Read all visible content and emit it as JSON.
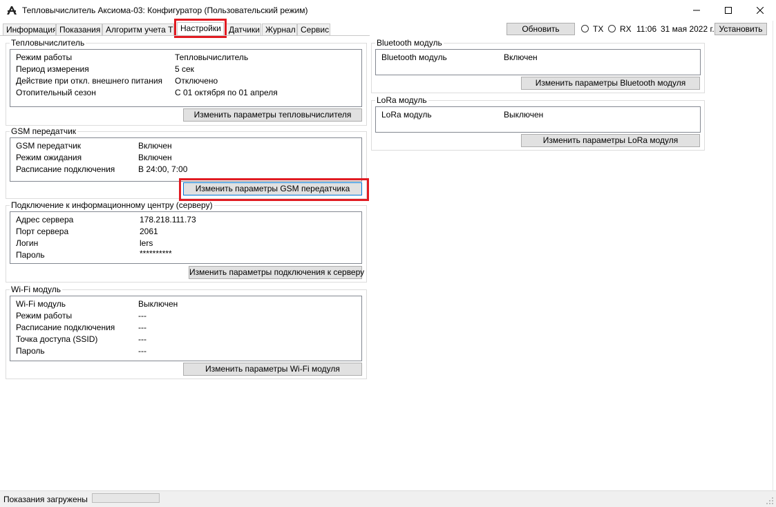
{
  "window": {
    "title": "Тепловычислитель Аксиома-03: Конфигуратор (Пользовательский режим)",
    "app_icon": "axioma-logo-icon",
    "controls": {
      "minimize": "minimize-icon",
      "maximize": "maximize-icon",
      "close": "close-icon"
    }
  },
  "tabs": [
    {
      "label": "Информация"
    },
    {
      "label": "Показания"
    },
    {
      "label": "Алгоритм учета ТЭ"
    },
    {
      "label": "Настройки",
      "active": true
    },
    {
      "label": "Датчики"
    },
    {
      "label": "Журнал"
    },
    {
      "label": "Сервис"
    }
  ],
  "toolbar": {
    "refresh_label": "Обновить",
    "tx_label": "TX",
    "rx_label": "RX",
    "time": "11:06",
    "date": "31 мая 2022 г.",
    "set_label": "Установить"
  },
  "groups": {
    "heat": {
      "title": "Тепловычислитель",
      "rows": [
        {
          "label": "Режим работы",
          "value": "Тепловычислитель"
        },
        {
          "label": "Период измерения",
          "value": "5 сек"
        },
        {
          "label": "Действие при откл. внешнего питания",
          "value": "Отключено"
        },
        {
          "label": "Отопительный сезон",
          "value": "С 01 октября по 01 апреля"
        }
      ],
      "button": "Изменить параметры тепловычислителя"
    },
    "gsm": {
      "title": "GSM передатчик",
      "rows": [
        {
          "label": "GSM передатчик",
          "value": "Включен"
        },
        {
          "label": "Режим ожидания",
          "value": "Включен"
        },
        {
          "label": "Расписание подключения",
          "value": "В 24:00, 7:00"
        }
      ],
      "button": "Изменить параметры GSM передатчика"
    },
    "server": {
      "title": "Подключение к информационному центру (серверу)",
      "rows": [
        {
          "label": "Адрес сервера",
          "value": "178.218.111.73"
        },
        {
          "label": "Порт сервера",
          "value": "2061"
        },
        {
          "label": "Логин",
          "value": "lers"
        },
        {
          "label": "Пароль",
          "value": "**********"
        }
      ],
      "button": "Изменить параметры подключения к серверу"
    },
    "wifi": {
      "title": "Wi-Fi модуль",
      "rows": [
        {
          "label": "Wi-Fi модуль",
          "value": "Выключен"
        },
        {
          "label": "Режим работы",
          "value": "---"
        },
        {
          "label": "Расписание подключения",
          "value": "---"
        },
        {
          "label": "Точка доступа (SSID)",
          "value": "---"
        },
        {
          "label": "Пароль",
          "value": "---"
        }
      ],
      "button": "Изменить параметры Wi-Fi модуля"
    },
    "bluetooth": {
      "title": "Bluetooth модуль",
      "rows": [
        {
          "label": "Bluetooth модуль",
          "value": "Включен"
        }
      ],
      "button": "Изменить параметры Bluetooth модуля"
    },
    "lora": {
      "title": "LoRa модуль",
      "rows": [
        {
          "label": "LoRa модуль",
          "value": "Выключен"
        }
      ],
      "button": "Изменить параметры LoRa модуля"
    }
  },
  "status": {
    "text": "Показания загружены"
  },
  "colors": {
    "highlight": "#e11b22",
    "focus": "#0078d7"
  }
}
